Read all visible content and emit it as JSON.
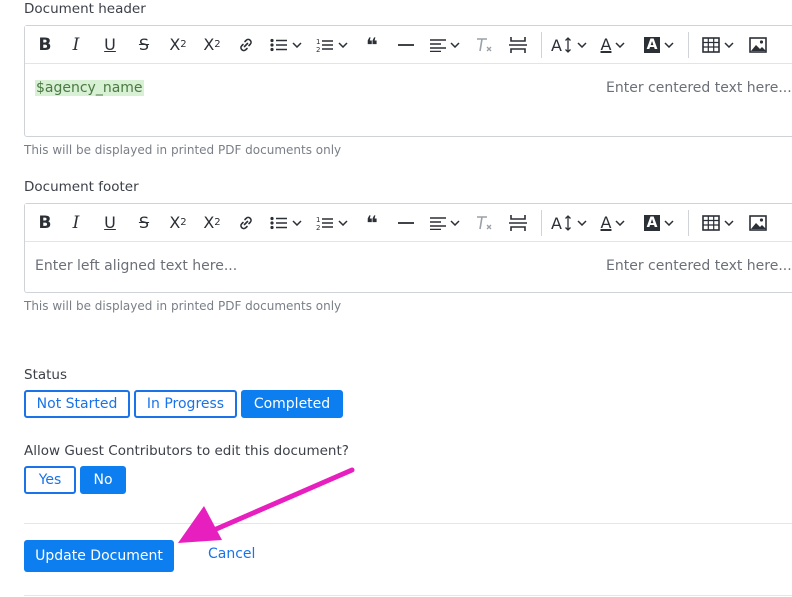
{
  "header_field": {
    "label": "Document header",
    "content_variable": "$agency_name",
    "center_placeholder": "Enter centered text here...",
    "hint": "This will be displayed in printed PDF documents only"
  },
  "footer_field": {
    "label": "Document footer",
    "left_placeholder": "Enter left aligned text here...",
    "center_placeholder": "Enter centered text here...",
    "hint": "This will be displayed in printed PDF documents only"
  },
  "toolbar": {
    "bold": "B",
    "italic": "I",
    "underline": "U",
    "strike": "S",
    "subscript": "X",
    "subscript_mark": "2",
    "superscript": "X",
    "superscript_mark": "2",
    "quote": "❝",
    "text_color": "A",
    "highlight": "A",
    "icons": [
      "bold-icon",
      "italic-icon",
      "underline-icon",
      "strikethrough-icon",
      "subscript-icon",
      "superscript-icon",
      "link-icon",
      "bullet-list-icon",
      "numbered-list-icon",
      "blockquote-icon",
      "horizontal-rule-icon",
      "align-icon",
      "clear-format-icon",
      "page-break-icon",
      "font-size-icon",
      "text-color-icon",
      "highlight-icon",
      "table-icon",
      "image-icon"
    ]
  },
  "status": {
    "label": "Status",
    "options": [
      "Not Started",
      "In Progress",
      "Completed"
    ],
    "selected": "Completed"
  },
  "guest": {
    "label": "Allow Guest Contributors to edit this document?",
    "options": [
      "Yes",
      "No"
    ],
    "selected": "No"
  },
  "actions": {
    "submit_label": "Update Document",
    "cancel_label": "Cancel"
  },
  "colors": {
    "accent": "#0d7ef0",
    "annotation_arrow": "#e81fbf",
    "variable_chip": "#d8f0d3"
  }
}
